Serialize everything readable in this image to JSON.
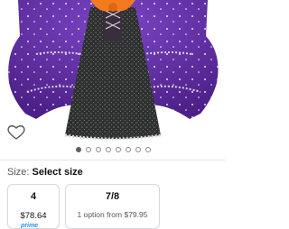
{
  "product": {
    "image_alt_icon": "heart-icon"
  },
  "carousel": {
    "count": 8,
    "active_index": 0
  },
  "size": {
    "label": "Size:",
    "value": "Select size"
  },
  "options": [
    {
      "name": "4",
      "price": "$78.64",
      "badge": "prime"
    },
    {
      "name": "7/8",
      "detail": "1 option from $79.95"
    }
  ],
  "colors": {
    "purple": "#5b2a9c",
    "orange": "#f47a1f",
    "text": "#0f1111",
    "muted": "#565959",
    "prime_blue": "#1a98ff"
  }
}
